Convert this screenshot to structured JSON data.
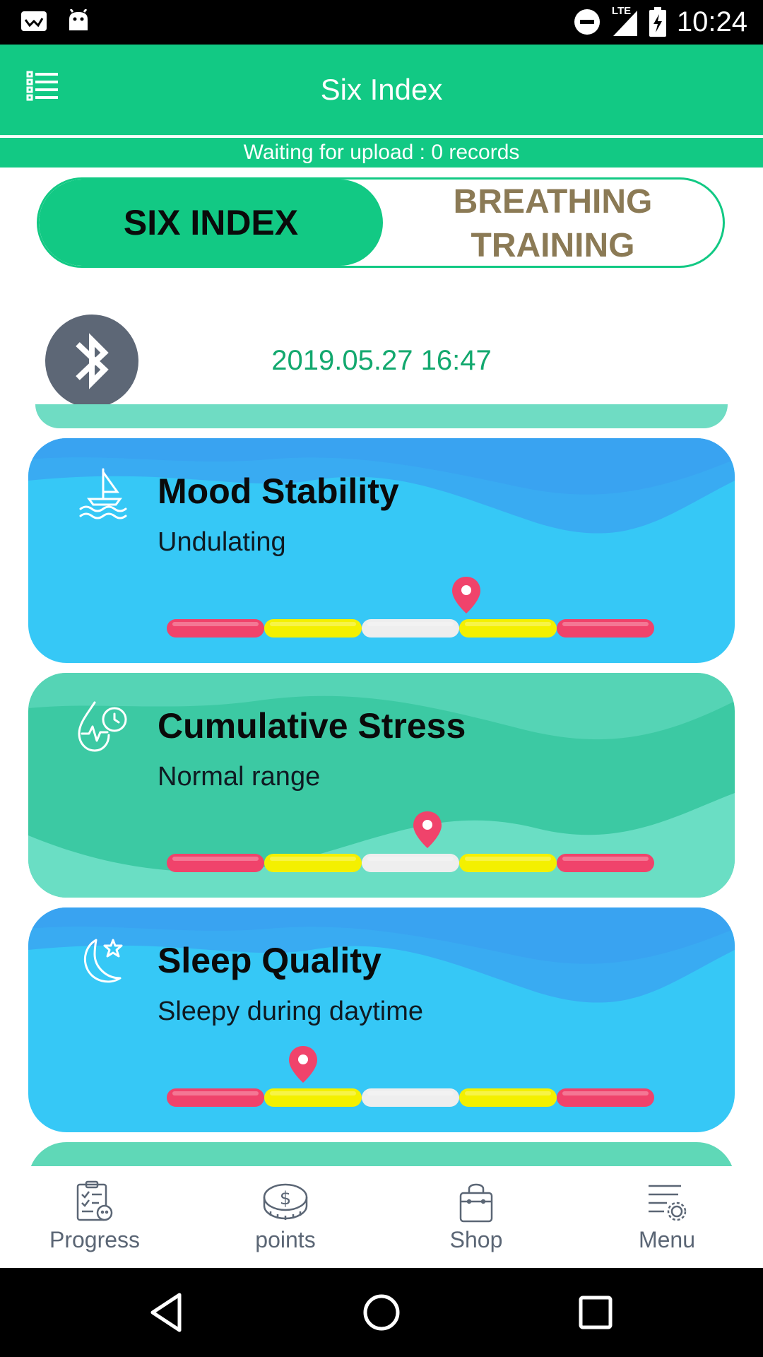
{
  "status_bar": {
    "time": "10:24",
    "network": "LTE",
    "left_icons": [
      "gallery-notification-icon",
      "android-notification-icon"
    ],
    "right_icons": [
      "do-not-disturb-icon",
      "lte-signal-icon",
      "battery-charging-icon"
    ]
  },
  "app_bar": {
    "title": "Six Index",
    "menu_icon": "list-menu-icon"
  },
  "upload_banner": "Waiting for upload : 0 records",
  "tabs": {
    "six_index": "SIX INDEX",
    "breathing_line1": "BREATHING",
    "breathing_line2": "TRAINING",
    "selected": "SIX INDEX"
  },
  "device": {
    "icon": "bluetooth-icon",
    "timestamp": "2019.05.27 16:47"
  },
  "cards": [
    {
      "title": "Mood Stability",
      "status": "Undulating",
      "icon": "sailboat-icon",
      "theme": "blue",
      "marker_fraction": 0.615
    },
    {
      "title": "Cumulative Stress",
      "status": "Normal range",
      "icon": "stress-heartbeat-icon",
      "theme": "green",
      "marker_fraction": 0.535
    },
    {
      "title": "Sleep Quality",
      "status": "Sleepy during daytime",
      "icon": "moon-star-icon",
      "theme": "blue",
      "marker_fraction": 0.28
    }
  ],
  "scale_segments": [
    "red",
    "yellow",
    "white",
    "yellow",
    "red"
  ],
  "colors": {
    "brand_green": "#12c984",
    "card_blue": "#36c8f6",
    "card_green": "#3cc9a3",
    "scale_red": "#f0436b",
    "scale_yellow": "#f4f000",
    "scale_white": "#eeeeee",
    "marker": "#f0436b"
  },
  "bottom_nav": [
    {
      "label": "Progress",
      "icon": "progress-clipboard-icon"
    },
    {
      "label": "points",
      "icon": "coins-icon"
    },
    {
      "label": "Shop",
      "icon": "shopping-bag-icon"
    },
    {
      "label": "Menu",
      "icon": "settings-menu-icon"
    }
  ],
  "system_nav": [
    "back-icon",
    "home-icon",
    "recents-icon"
  ]
}
